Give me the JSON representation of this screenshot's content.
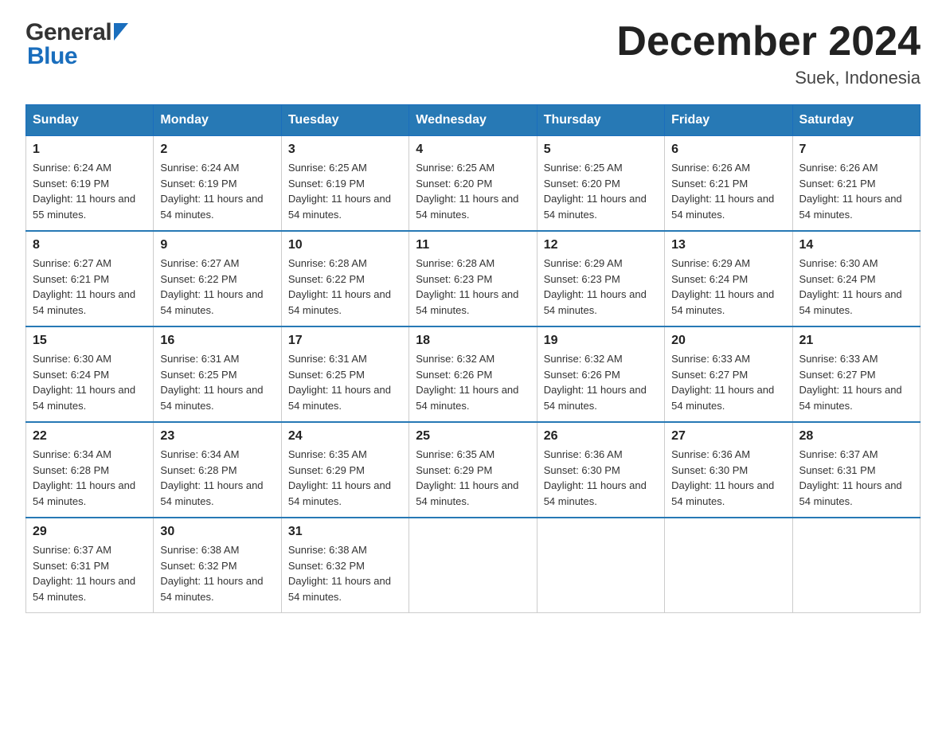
{
  "logo": {
    "general": "General",
    "blue": "Blue"
  },
  "title": {
    "month": "December 2024",
    "location": "Suek, Indonesia"
  },
  "weekdays": [
    "Sunday",
    "Monday",
    "Tuesday",
    "Wednesday",
    "Thursday",
    "Friday",
    "Saturday"
  ],
  "weeks": [
    [
      {
        "day": "1",
        "sunrise": "6:24 AM",
        "sunset": "6:19 PM",
        "daylight": "11 hours and 55 minutes."
      },
      {
        "day": "2",
        "sunrise": "6:24 AM",
        "sunset": "6:19 PM",
        "daylight": "11 hours and 54 minutes."
      },
      {
        "day": "3",
        "sunrise": "6:25 AM",
        "sunset": "6:19 PM",
        "daylight": "11 hours and 54 minutes."
      },
      {
        "day": "4",
        "sunrise": "6:25 AM",
        "sunset": "6:20 PM",
        "daylight": "11 hours and 54 minutes."
      },
      {
        "day": "5",
        "sunrise": "6:25 AM",
        "sunset": "6:20 PM",
        "daylight": "11 hours and 54 minutes."
      },
      {
        "day": "6",
        "sunrise": "6:26 AM",
        "sunset": "6:21 PM",
        "daylight": "11 hours and 54 minutes."
      },
      {
        "day": "7",
        "sunrise": "6:26 AM",
        "sunset": "6:21 PM",
        "daylight": "11 hours and 54 minutes."
      }
    ],
    [
      {
        "day": "8",
        "sunrise": "6:27 AM",
        "sunset": "6:21 PM",
        "daylight": "11 hours and 54 minutes."
      },
      {
        "day": "9",
        "sunrise": "6:27 AM",
        "sunset": "6:22 PM",
        "daylight": "11 hours and 54 minutes."
      },
      {
        "day": "10",
        "sunrise": "6:28 AM",
        "sunset": "6:22 PM",
        "daylight": "11 hours and 54 minutes."
      },
      {
        "day": "11",
        "sunrise": "6:28 AM",
        "sunset": "6:23 PM",
        "daylight": "11 hours and 54 minutes."
      },
      {
        "day": "12",
        "sunrise": "6:29 AM",
        "sunset": "6:23 PM",
        "daylight": "11 hours and 54 minutes."
      },
      {
        "day": "13",
        "sunrise": "6:29 AM",
        "sunset": "6:24 PM",
        "daylight": "11 hours and 54 minutes."
      },
      {
        "day": "14",
        "sunrise": "6:30 AM",
        "sunset": "6:24 PM",
        "daylight": "11 hours and 54 minutes."
      }
    ],
    [
      {
        "day": "15",
        "sunrise": "6:30 AM",
        "sunset": "6:24 PM",
        "daylight": "11 hours and 54 minutes."
      },
      {
        "day": "16",
        "sunrise": "6:31 AM",
        "sunset": "6:25 PM",
        "daylight": "11 hours and 54 minutes."
      },
      {
        "day": "17",
        "sunrise": "6:31 AM",
        "sunset": "6:25 PM",
        "daylight": "11 hours and 54 minutes."
      },
      {
        "day": "18",
        "sunrise": "6:32 AM",
        "sunset": "6:26 PM",
        "daylight": "11 hours and 54 minutes."
      },
      {
        "day": "19",
        "sunrise": "6:32 AM",
        "sunset": "6:26 PM",
        "daylight": "11 hours and 54 minutes."
      },
      {
        "day": "20",
        "sunrise": "6:33 AM",
        "sunset": "6:27 PM",
        "daylight": "11 hours and 54 minutes."
      },
      {
        "day": "21",
        "sunrise": "6:33 AM",
        "sunset": "6:27 PM",
        "daylight": "11 hours and 54 minutes."
      }
    ],
    [
      {
        "day": "22",
        "sunrise": "6:34 AM",
        "sunset": "6:28 PM",
        "daylight": "11 hours and 54 minutes."
      },
      {
        "day": "23",
        "sunrise": "6:34 AM",
        "sunset": "6:28 PM",
        "daylight": "11 hours and 54 minutes."
      },
      {
        "day": "24",
        "sunrise": "6:35 AM",
        "sunset": "6:29 PM",
        "daylight": "11 hours and 54 minutes."
      },
      {
        "day": "25",
        "sunrise": "6:35 AM",
        "sunset": "6:29 PM",
        "daylight": "11 hours and 54 minutes."
      },
      {
        "day": "26",
        "sunrise": "6:36 AM",
        "sunset": "6:30 PM",
        "daylight": "11 hours and 54 minutes."
      },
      {
        "day": "27",
        "sunrise": "6:36 AM",
        "sunset": "6:30 PM",
        "daylight": "11 hours and 54 minutes."
      },
      {
        "day": "28",
        "sunrise": "6:37 AM",
        "sunset": "6:31 PM",
        "daylight": "11 hours and 54 minutes."
      }
    ],
    [
      {
        "day": "29",
        "sunrise": "6:37 AM",
        "sunset": "6:31 PM",
        "daylight": "11 hours and 54 minutes."
      },
      {
        "day": "30",
        "sunrise": "6:38 AM",
        "sunset": "6:32 PM",
        "daylight": "11 hours and 54 minutes."
      },
      {
        "day": "31",
        "sunrise": "6:38 AM",
        "sunset": "6:32 PM",
        "daylight": "11 hours and 54 minutes."
      },
      null,
      null,
      null,
      null
    ]
  ]
}
